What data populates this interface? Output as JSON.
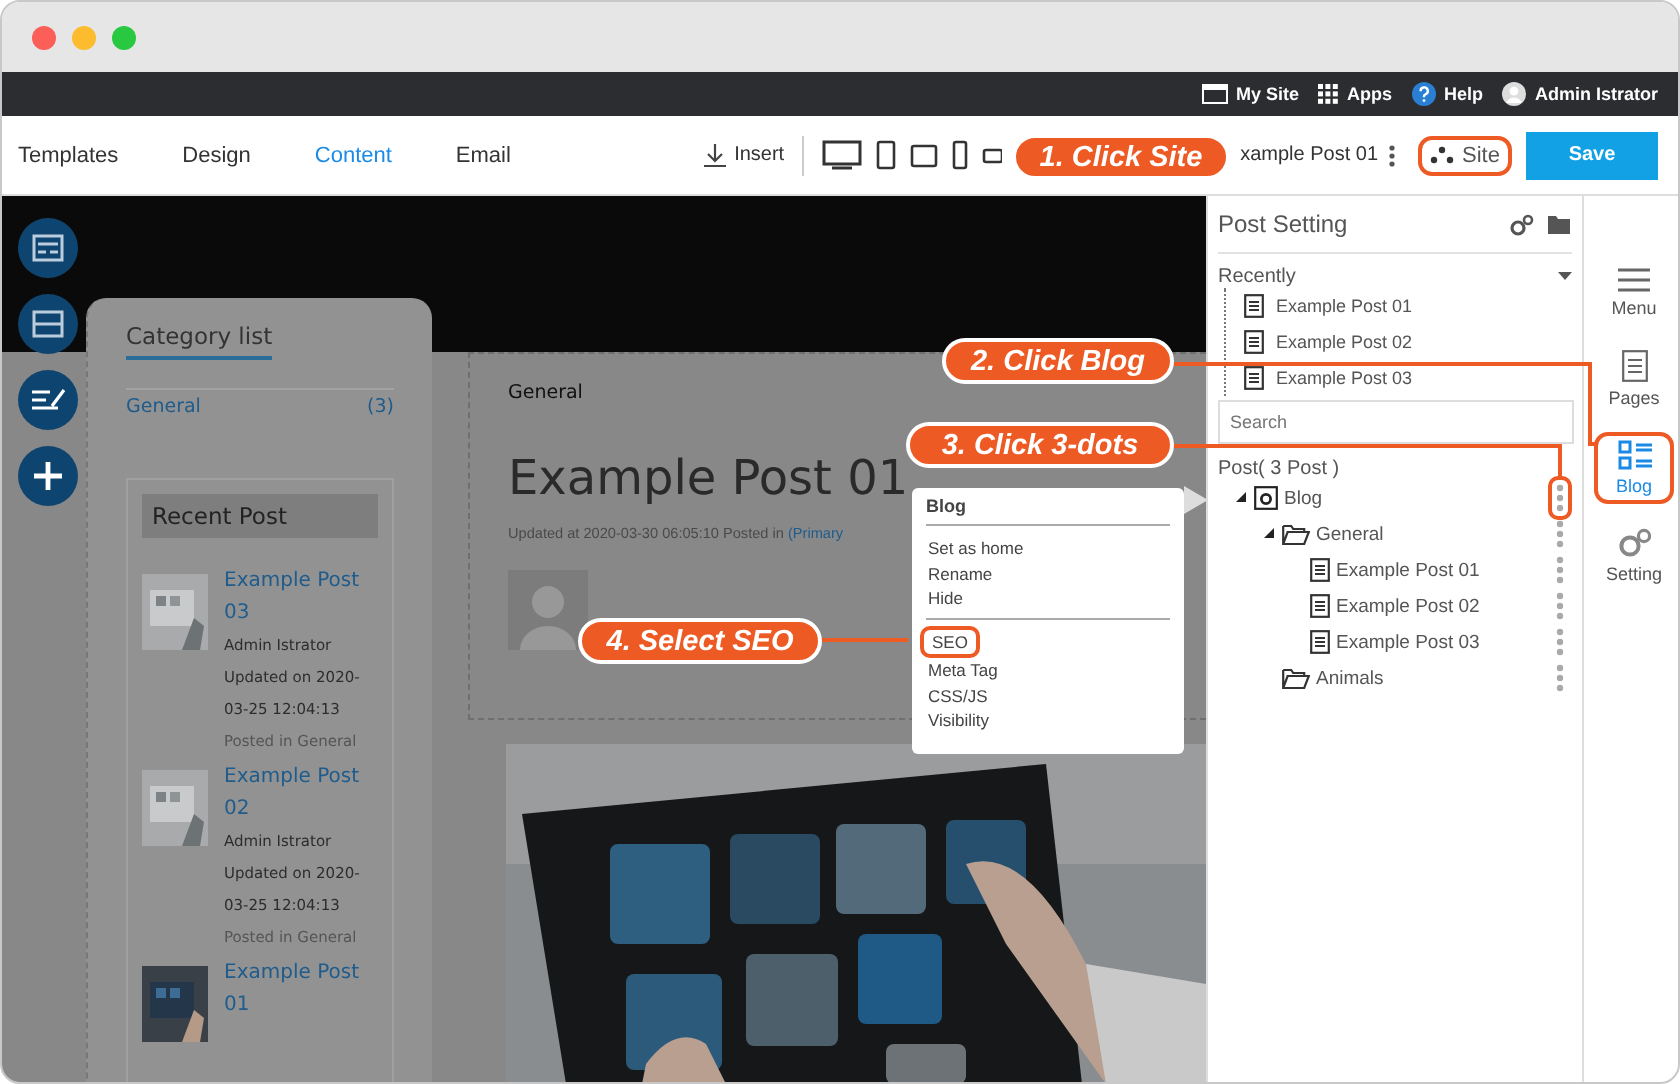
{
  "top_bar": {
    "items": [
      {
        "label": "My Site"
      },
      {
        "label": "Apps"
      },
      {
        "label": "Help"
      },
      {
        "label": "Admin Istrator"
      }
    ]
  },
  "toolbar": {
    "tabs": [
      {
        "label": "Templates",
        "selected": false
      },
      {
        "label": "Design",
        "selected": false
      },
      {
        "label": "Content",
        "selected": true
      },
      {
        "label": "Email",
        "selected": false
      }
    ],
    "insert": "Insert",
    "page": "xample Post 01",
    "site": {
      "label": "Site",
      "highlighted": true
    },
    "save": "Save"
  },
  "canvas": {
    "category_list": {
      "title": "Category list",
      "items": [
        {
          "name": "General",
          "count": "(3)"
        }
      ]
    },
    "recent_post": {
      "title": "Recent Post",
      "posts": [
        {
          "title": "Example Post 03",
          "author": "Admin Istrator",
          "updated": "Updated on 2020-03-25 12:04:13",
          "category": "Posted in General"
        },
        {
          "title": "Example Post 02",
          "author": "Admin Istrator",
          "updated": "Updated on 2020-03-25 12:04:13",
          "category": "Posted in General"
        },
        {
          "title": "Example Post 01"
        }
      ]
    },
    "post": {
      "category": "General",
      "title": "Example Post 01",
      "meta": "Updated at 2020-03-30 06:05:10 Posted in ",
      "meta_link": "(Primary"
    }
  },
  "context_menu": {
    "title": "Blog",
    "groups": [
      [
        {
          "label": "Set as home",
          "highlighted": false
        },
        {
          "label": "Rename",
          "highlighted": false
        },
        {
          "label": "Hide",
          "highlighted": false
        }
      ],
      [
        {
          "label": "SEO",
          "highlighted": true
        },
        {
          "label": "Meta Tag",
          "highlighted": false
        },
        {
          "label": "CSS/JS",
          "highlighted": false
        },
        {
          "label": "Visibility",
          "highlighted": false
        }
      ]
    ]
  },
  "post_setting": {
    "title": "Post Setting",
    "recently": {
      "label": "Recently",
      "items": [
        "Example Post 01",
        "Example Post 02",
        "Example Post 03"
      ]
    },
    "search": {
      "placeholder": "Search"
    },
    "post_count": "Post( 3 Post )",
    "tree": [
      {
        "label": "Blog",
        "kind": "blog",
        "highlighted": true,
        "children": [
          {
            "label": "General",
            "kind": "folder",
            "highlighted": false,
            "children": [
              {
                "label": "Example Post 01",
                "kind": "post",
                "highlighted": false
              },
              {
                "label": "Example Post 02",
                "kind": "post",
                "highlighted": false
              },
              {
                "label": "Example Post 03",
                "kind": "post",
                "highlighted": false
              }
            ]
          },
          {
            "label": "Animals",
            "kind": "folder",
            "highlighted": false
          }
        ]
      }
    ]
  },
  "side_rail": {
    "items": [
      {
        "label": "Menu",
        "kind": "menu",
        "selected": false,
        "highlighted": false
      },
      {
        "label": "Pages",
        "kind": "pages",
        "selected": false,
        "highlighted": false
      },
      {
        "label": "Blog",
        "kind": "blog",
        "selected": true,
        "highlighted": true
      },
      {
        "label": "Setting",
        "kind": "setting",
        "selected": false,
        "highlighted": false
      }
    ]
  },
  "callouts": [
    {
      "label": "1. Click Site"
    },
    {
      "label": "2. Click Blog"
    },
    {
      "label": "3. Click 3-dots"
    },
    {
      "label": "4. Select SEO"
    }
  ]
}
